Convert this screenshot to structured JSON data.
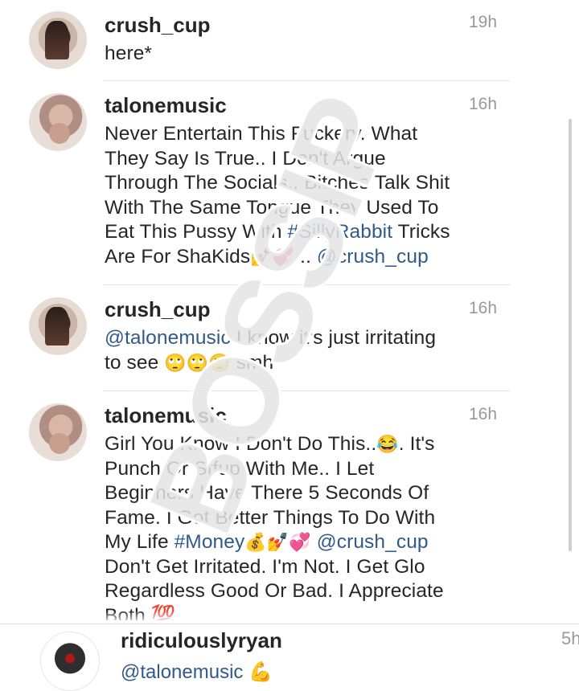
{
  "comments": [
    {
      "username": "crush_cup",
      "time": "19h",
      "text": "here*"
    },
    {
      "username": "talonemusic",
      "time": "16h",
      "text_parts": {
        "line1": "Never Entertain This Fuckery. What",
        "line2": "They Say Is True.. I Don't Argue",
        "line3": "Through The Socials.. Bitches Talk Shit",
        "line4": "With The Same Tongue They Used To",
        "line5_pre": "Eat This Pussy With ",
        "hashtag": "#SillyRabbit",
        "line5_post": " Tricks",
        "line6_pre": "Are For ShaKids",
        "emoji": "💅💞",
        "line6_mid": " .. ",
        "mention": "@crush_cup"
      }
    },
    {
      "username": "crush_cup",
      "time": "16h",
      "text_parts": {
        "mention": "@talonemusic",
        "line1_post": " I know it's just irritating",
        "line2_pre": "to see ",
        "emoji": "🙄🙄🙄",
        "line2_post": " smh"
      }
    },
    {
      "username": "talonemusic",
      "time": "16h",
      "text_parts": {
        "line1_pre": "Girl You Know I Don't Do This..",
        "emoji1": "😂",
        "line1_post": ". It's",
        "line2": "Punch Or Stfup With Me.. I Let",
        "line3": "Beginners Have There 5 Seconds Of",
        "line4": "Fame. I Got Better Things To Do With",
        "line5_pre": "My Life ",
        "hashtag": "#Money",
        "emoji2": "💰💅💞",
        "line5_gap": " ",
        "mention": "@crush_cup",
        "line6": "Don't Get Irritated. I'm Not. I Get Glo",
        "line7": "Regardless Good Or Bad. I Appreciate",
        "line8": "Both 💯"
      }
    }
  ],
  "next_comment": {
    "username": "ridiculouslyryan",
    "time": "5h",
    "text": "@talonemusic 💪"
  },
  "watermark": {
    "text": "BOSSIP",
    "color": "#e2e2e2"
  },
  "colors": {
    "link": "#2f5a8a",
    "text": "#262626",
    "time": "#999999"
  }
}
